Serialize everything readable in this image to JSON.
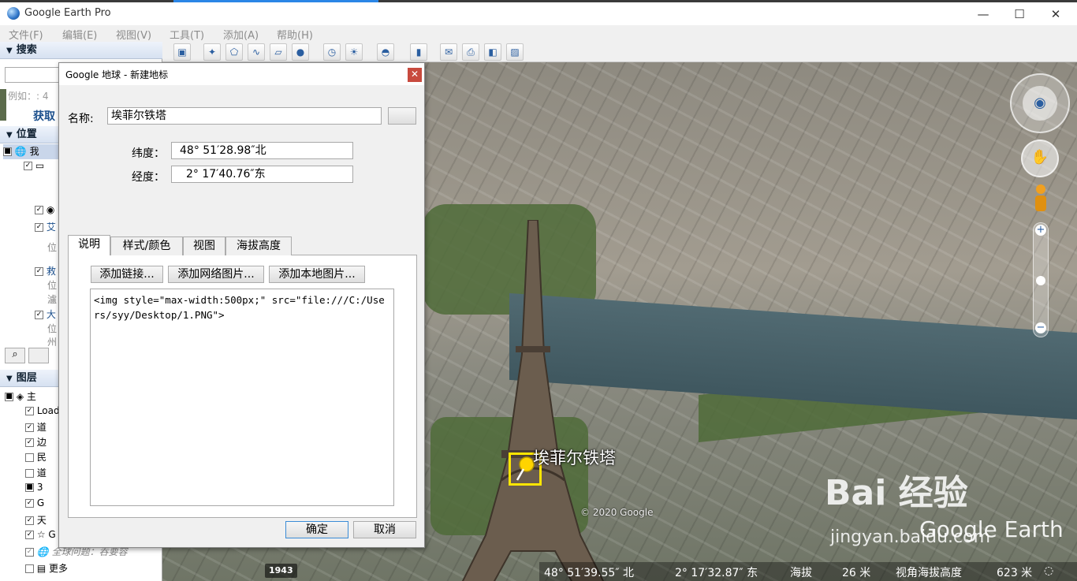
{
  "window": {
    "title": "Google Earth Pro",
    "minimize": "—",
    "maximize": "☐",
    "close": "✕"
  },
  "menu": [
    "文件(F)",
    "编辑(E)",
    "视图(V)",
    "工具(T)",
    "添加(A)",
    "帮助(H)"
  ],
  "left": {
    "search_header": "搜索",
    "example_text": "例如：: 4",
    "get_btn": "获取",
    "places_header": "位置",
    "places_items": [
      "我",
      "艾",
      "位",
      "救",
      "位",
      "瀘",
      "大",
      "位",
      "州"
    ],
    "layers_header": "图层",
    "layers_items": [
      "主",
      "Load",
      "道",
      "边",
      "民",
      "道",
      "3",
      "G",
      "天",
      "G",
      "全球问题：吞要容"
    ],
    "more_label": "更多"
  },
  "dialog": {
    "title": "Google 地球 - 新建地标",
    "name_label": "名称:",
    "name_value": "埃菲尔铁塔",
    "lat_label": "纬度：",
    "lat_value": "48° 51′28.98″北",
    "lon_label": "经度：",
    "lon_value": "2° 17′40.76″东",
    "tabs": [
      "说明",
      "样式/颜色",
      "视图",
      "海拔高度"
    ],
    "add_link": "添加链接...",
    "add_web_image": "添加网络图片...",
    "add_local_image": "添加本地图片...",
    "description": "<img style=\"max-width:500px;\" src=\"file:///C:/Users/syy/Desktop/1.PNG\">",
    "ok": "确定",
    "cancel": "取消"
  },
  "map": {
    "placemark_label": "埃菲尔铁塔",
    "copyright": "© 2020 Google",
    "year": "1943",
    "status": {
      "lat": "48° 51′39.55″ 北",
      "lon": "2° 17′32.87″ 东",
      "elev_label": "海拔",
      "elev_value": "26 米",
      "eye_label": "视角海拔高度",
      "eye_value": "623 米"
    },
    "watermark": "Bai 经验",
    "watermark_url": "jingyan.baidu.com",
    "watermark_ge": "Google Earth"
  },
  "colors": {
    "accent": "#2b86e6",
    "dialog_close": "#c84a3e",
    "pin_box": "#ffe600"
  }
}
